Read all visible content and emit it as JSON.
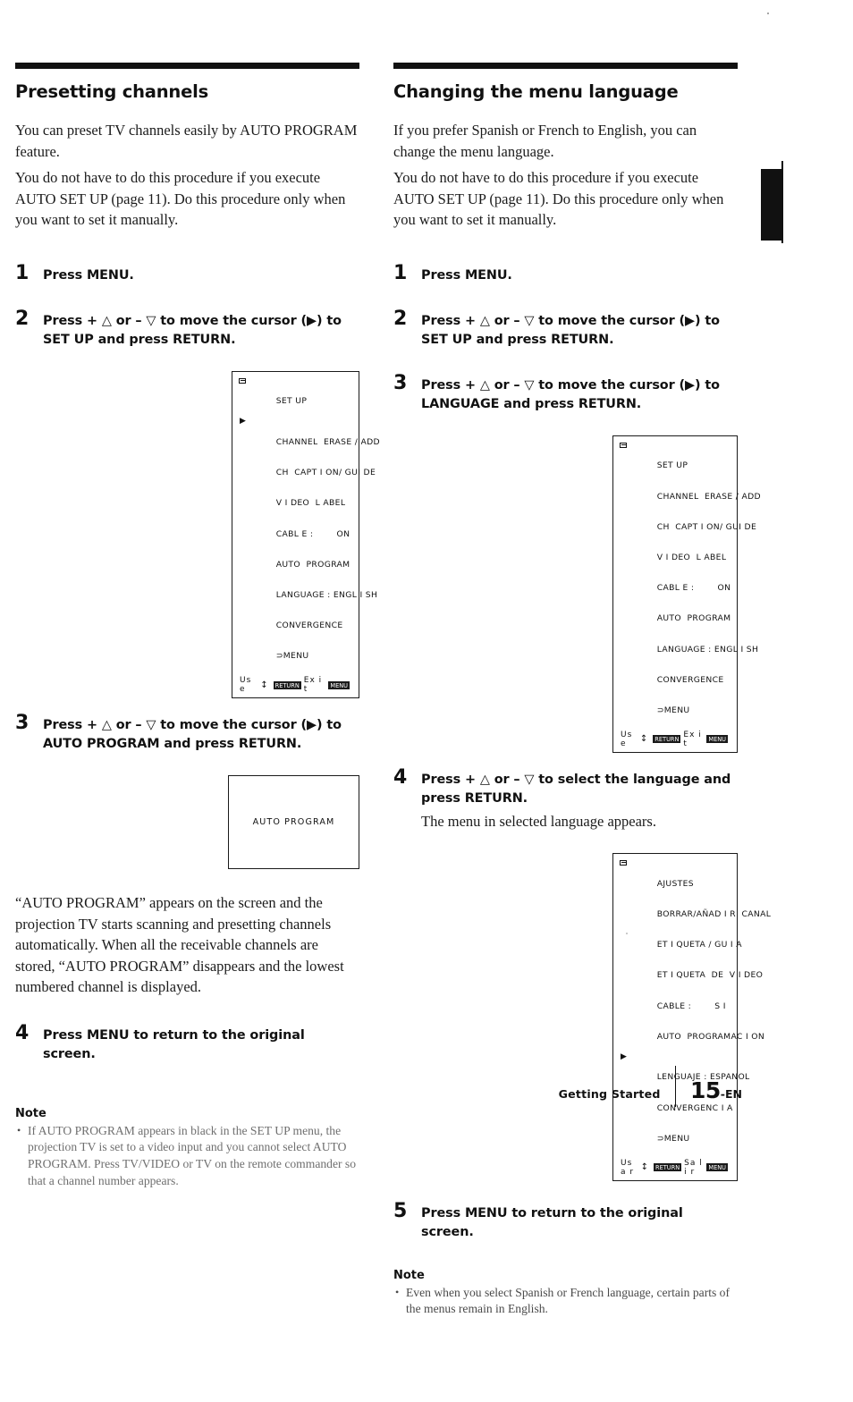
{
  "page": {
    "footer_section": "Getting Started",
    "footer_page_number": "15",
    "footer_page_suffix": "-EN"
  },
  "left_column": {
    "heading": "Presetting channels",
    "intro_paragraphs": [
      "You can preset TV channels easily by AUTO PROGRAM feature.",
      "You do not have to do this procedure if you execute AUTO SET UP (page 11).  Do this procedure only when you want to set it manually."
    ],
    "steps": [
      {
        "num": "1",
        "text": "Press MENU."
      },
      {
        "num": "2",
        "text": "Press + △ or – ▽ to move the cursor (▶) to SET UP and press RETURN."
      },
      {
        "num": "3",
        "text": "Press + △ or – ▽ to move the cursor (▶) to AUTO PROGRAM and press RETURN."
      },
      {
        "num": "4",
        "text": "Press MENU to return to the original screen."
      }
    ],
    "setup_menu": {
      "title": "SET UP",
      "items": [
        {
          "label": "CHANNEL  ERASE / ADD",
          "cursor": true
        },
        {
          "label": "CH  CAPT I ON/ GUI DE",
          "cursor": false
        },
        {
          "label": "V I DEO  L ABEL",
          "cursor": false
        },
        {
          "label": "CABL E :        ON",
          "cursor": false
        },
        {
          "label": "AUTO  PROGRAM",
          "cursor": false
        },
        {
          "label": "LANGUAGE : ENGL I SH",
          "cursor": false
        },
        {
          "label": "CONVERGENCE",
          "cursor": false
        },
        {
          "label": "⊃MENU",
          "cursor": false
        }
      ],
      "footer_use_label": "Us e",
      "footer_use_badge": "RETURN",
      "footer_exit_label": "Ex i t",
      "footer_exit_badge": "MENU"
    },
    "auto_program_screen": {
      "label": "AUTO  PROGRAM"
    },
    "after_screen_paragraph": "“AUTO PROGRAM” appears on the screen and the projection TV starts scanning and presetting channels automatically.  When all the receivable channels are stored, “AUTO PROGRAM” disappears and the lowest numbered channel is displayed.",
    "note": {
      "heading": "Note",
      "items": [
        "If AUTO PROGRAM appears in black in the SET UP menu, the projection TV is set to a video input and you cannot select AUTO PROGRAM.  Press TV/VIDEO or TV on the remote commander so that a channel number appears."
      ]
    }
  },
  "right_column": {
    "heading": "Changing the menu language",
    "intro_paragraphs": [
      "If you prefer Spanish or French to English, you can change the menu language.",
      "You do not have to do this procedure if you execute AUTO SET UP (page 11).  Do this procedure only when you want to set it manually."
    ],
    "steps": [
      {
        "num": "1",
        "text": "Press MENU."
      },
      {
        "num": "2",
        "text": "Press + △ or – ▽ to move the cursor (▶) to SET UP and press RETURN."
      },
      {
        "num": "3",
        "text": "Press + △ or – ▽ to move the cursor (▶) to LANGUAGE and press RETURN."
      },
      {
        "num": "4",
        "text": "Press + △ or – ▽ to select the language and press RETURN.",
        "sub": "The menu in selected language appears."
      },
      {
        "num": "5",
        "text": "Press MENU to return to the original screen."
      }
    ],
    "setup_menu": {
      "title": "SET UP",
      "items": [
        {
          "label": "CHANNEL  ERASE / ADD",
          "cursor": false
        },
        {
          "label": "CH  CAPT I ON/ GUI DE",
          "cursor": false
        },
        {
          "label": "V I DEO  L ABEL",
          "cursor": false
        },
        {
          "label": "CABL E :        ON",
          "cursor": false
        },
        {
          "label": "AUTO  PROGRAM",
          "cursor": false
        },
        {
          "label": "LANGUAGE : ENGL I SH",
          "cursor": false
        },
        {
          "label": "CONVERGENCE",
          "cursor": false
        },
        {
          "label": "⊃MENU",
          "cursor": false
        }
      ],
      "footer_use_label": "Us e",
      "footer_use_badge": "RETURN",
      "footer_exit_label": "Ex i t",
      "footer_exit_badge": "MENU"
    },
    "spanish_menu": {
      "title": "AJUSTES",
      "items": [
        {
          "label": "BORRAR/AÑAD I R  CANAL",
          "cursor": false
        },
        {
          "label": "ET I QUETA / GU I A",
          "cursor": false
        },
        {
          "label": "ET I QUETA  DE  V I DEO",
          "cursor": false
        },
        {
          "label": "CABLE :        S I",
          "cursor": false
        },
        {
          "label": "AUTO  PROGRAMAC I ON",
          "cursor": false
        },
        {
          "label": "LENGUAJE : ESPANOL",
          "cursor": true
        },
        {
          "label": "CONVERGENC I A",
          "cursor": false
        },
        {
          "label": "⊃MENU",
          "cursor": false
        }
      ],
      "footer_use_label": "Us a r",
      "footer_use_badge": "RETURN",
      "footer_exit_label": "Sa l i r",
      "footer_exit_badge": "MENU"
    },
    "note": {
      "heading": "Note",
      "items": [
        "Even when you select Spanish or French language, certain parts of the menus remain in English."
      ]
    }
  }
}
